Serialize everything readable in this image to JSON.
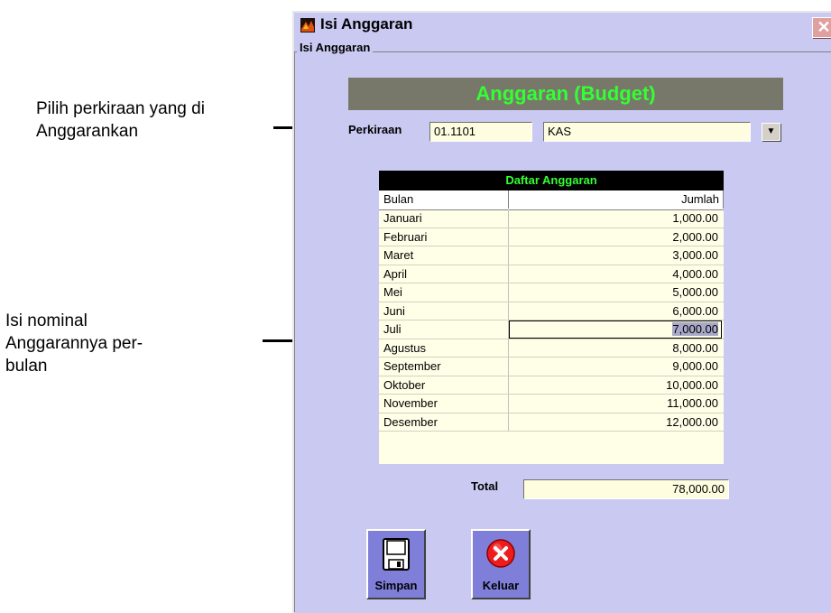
{
  "annotations": {
    "perkiraan_note": "Pilih perkiraan yang di\nAnggarankan",
    "nominal_note": "Isi nominal\nAnggarannya per-\nbulan"
  },
  "window": {
    "title": "Isi Anggaran",
    "close_symbol": "✕"
  },
  "group": {
    "label": "Isi Anggaran"
  },
  "header": {
    "title": "Anggaran (Budget)"
  },
  "perkiraan": {
    "label": "Perkiraan",
    "code": "01.1101",
    "name": "KAS",
    "dropdown_symbol": "▼"
  },
  "grid": {
    "title": "Daftar Anggaran",
    "columns": [
      "Bulan",
      "Jumlah"
    ],
    "rows": [
      {
        "bulan": "Januari",
        "jumlah": "1,000.00"
      },
      {
        "bulan": "Februari",
        "jumlah": "2,000.00"
      },
      {
        "bulan": "Maret",
        "jumlah": "3,000.00"
      },
      {
        "bulan": "April",
        "jumlah": "4,000.00"
      },
      {
        "bulan": "Mei",
        "jumlah": "5,000.00"
      },
      {
        "bulan": "Juni",
        "jumlah": "6,000.00"
      },
      {
        "bulan": "Juli",
        "jumlah": "7,000.00"
      },
      {
        "bulan": "Agustus",
        "jumlah": "8,000.00"
      },
      {
        "bulan": "September",
        "jumlah": "9,000.00"
      },
      {
        "bulan": "Oktober",
        "jumlah": "10,000.00"
      },
      {
        "bulan": "November",
        "jumlah": "11,000.00"
      },
      {
        "bulan": "Desember",
        "jumlah": "12,000.00"
      }
    ],
    "selected_row": "Juli"
  },
  "total": {
    "label": "Total",
    "value": "78,000.00"
  },
  "buttons": {
    "save_label": "Simpan",
    "exit_label": "Keluar",
    "save_icon": "floppy-disk-icon",
    "exit_icon": "close-circle-icon"
  },
  "colors": {
    "window_bg": "#c9c9f2",
    "header_text": "#33ff33",
    "field_bg": "#fffde0",
    "button_bg": "#7f7fd9"
  }
}
